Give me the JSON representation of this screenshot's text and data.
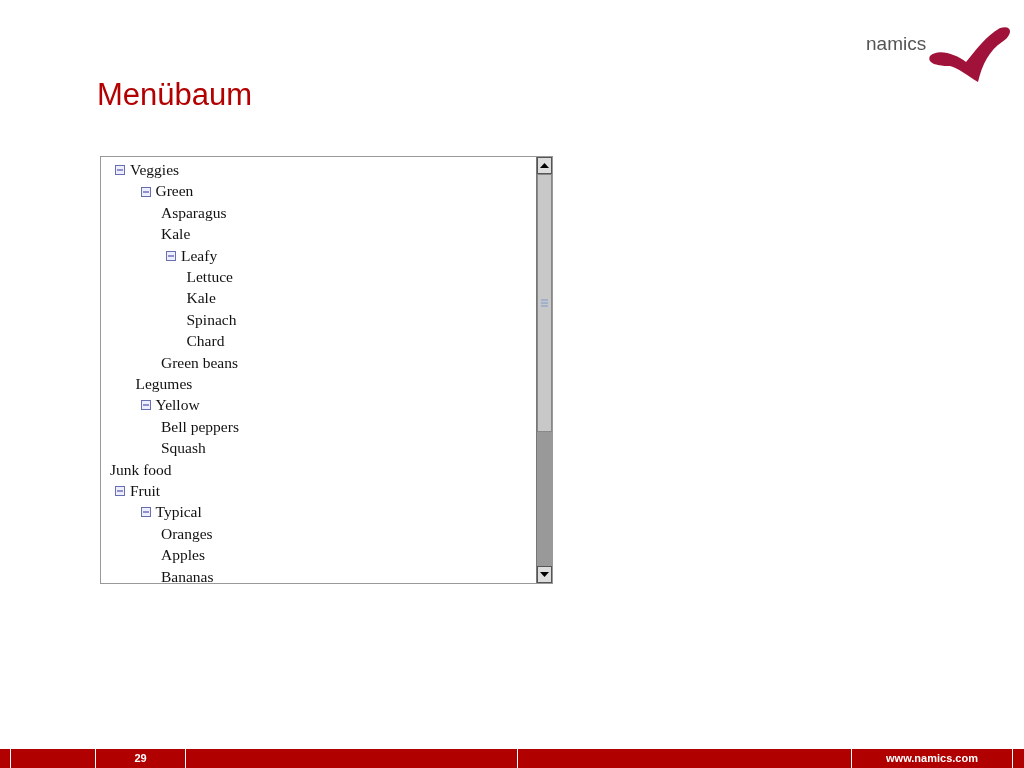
{
  "slide": {
    "title": "Menübaum",
    "logo": "namics"
  },
  "tree": [
    {
      "label": "Veggies",
      "expanded": true,
      "children": [
        {
          "label": "Green",
          "expanded": true,
          "children": [
            {
              "label": "Asparagus"
            },
            {
              "label": "Kale"
            },
            {
              "label": "Leafy",
              "expanded": true,
              "children": [
                {
                  "label": "Lettuce"
                },
                {
                  "label": "Kale"
                },
                {
                  "label": "Spinach"
                },
                {
                  "label": "Chard"
                }
              ]
            },
            {
              "label": "Green beans"
            }
          ]
        },
        {
          "label": "Legumes"
        },
        {
          "label": "Yellow",
          "expanded": true,
          "children": [
            {
              "label": "Bell peppers"
            },
            {
              "label": "Squash"
            }
          ]
        }
      ]
    },
    {
      "label": "Junk food"
    },
    {
      "label": "Fruit",
      "expanded": true,
      "children": [
        {
          "label": "Typical",
          "expanded": true,
          "children": [
            {
              "label": "Oranges"
            },
            {
              "label": "Apples"
            },
            {
              "label": "Bananas"
            }
          ]
        }
      ]
    }
  ],
  "footer": {
    "page_number": "29",
    "url": "www.namics.com"
  }
}
